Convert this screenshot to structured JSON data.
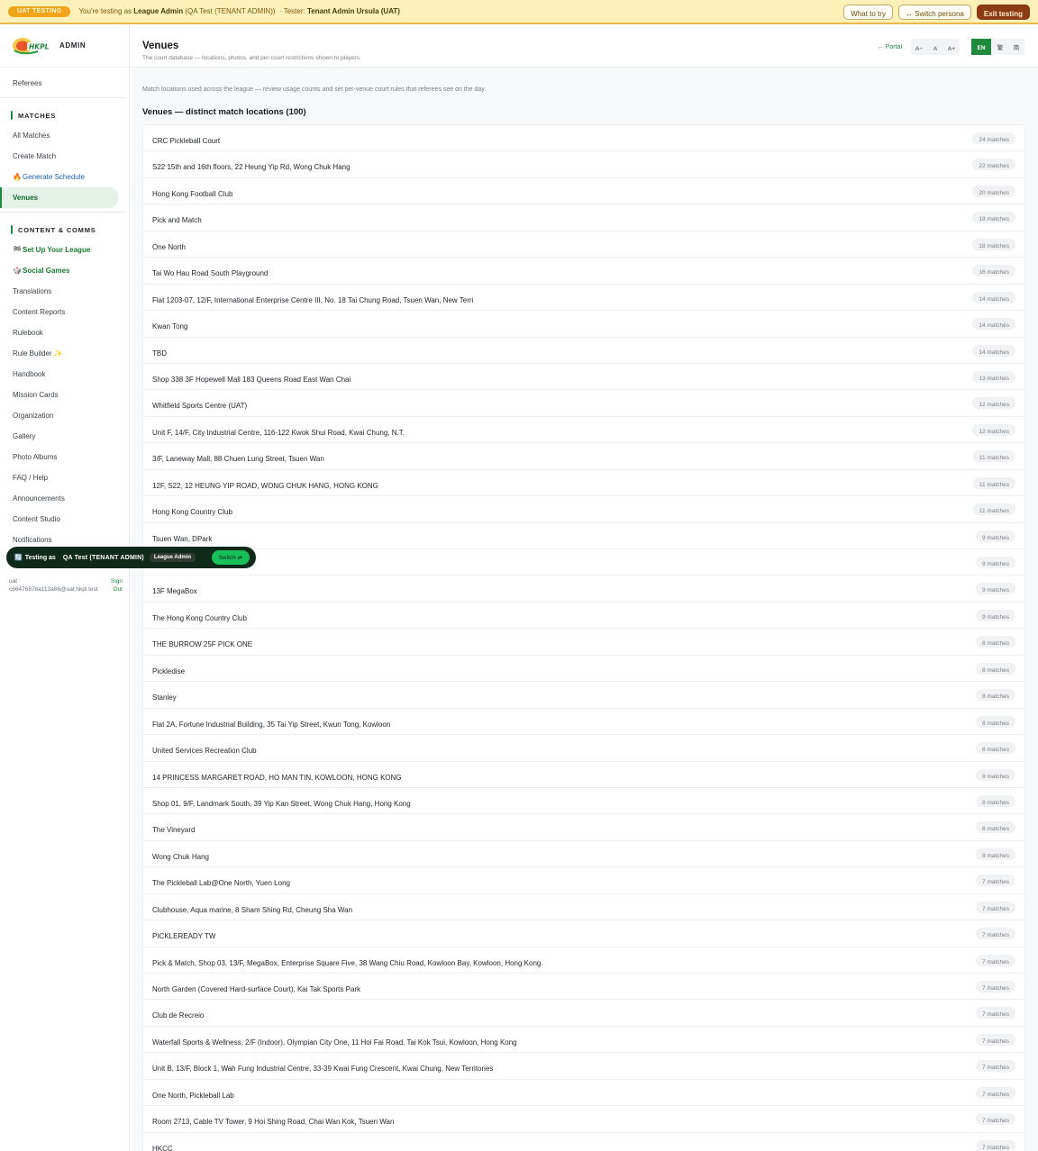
{
  "uat_banner": {
    "pill": "UAT TESTING",
    "prefix": "You're testing as",
    "role": "League Admin",
    "org": "(QA Test (TENANT ADMIN))",
    "tester_label": "· Tester:",
    "tester": "Tenant Admin Ursula (UAT)",
    "what_to_try": "What to try",
    "switch_persona": "↔ Switch persona",
    "exit": "Exit testing"
  },
  "brand": {
    "logo_text": "HKPL",
    "label": "ADMIN"
  },
  "sidebar": {
    "top_items": [
      "Referees"
    ],
    "sections": [
      {
        "heading": "MATCHES",
        "items": [
          {
            "label": "All Matches",
            "icon": "",
            "style": ""
          },
          {
            "label": "Create Match",
            "icon": "",
            "style": ""
          },
          {
            "label": "Generate Schedule",
            "icon": "fire-icon",
            "glyph": "🔥",
            "style": "blue"
          },
          {
            "label": "Venues",
            "icon": "",
            "style": "active"
          }
        ]
      },
      {
        "heading": "CONTENT & COMMS",
        "items": [
          {
            "label": "Set Up Your League",
            "icon": "league-setup-icon",
            "glyph": "🏁",
            "style": "green"
          },
          {
            "label": "Social Games",
            "icon": "dice-icon",
            "glyph": "🎲",
            "style": "green"
          },
          {
            "label": "Translations",
            "icon": "",
            "style": ""
          },
          {
            "label": "Content Reports",
            "icon": "",
            "style": ""
          },
          {
            "label": "Rulebook",
            "icon": "",
            "style": ""
          },
          {
            "label": "Rule Builder ✨",
            "icon": "",
            "style": ""
          },
          {
            "label": "Handbook",
            "icon": "",
            "style": ""
          },
          {
            "label": "Mission Cards",
            "icon": "",
            "style": ""
          },
          {
            "label": "Organization",
            "icon": "",
            "style": ""
          },
          {
            "label": "Gallery",
            "icon": "",
            "style": ""
          },
          {
            "label": "Photo Albums",
            "icon": "",
            "style": ""
          },
          {
            "label": "FAQ / Help",
            "icon": "",
            "style": ""
          },
          {
            "label": "Announcements",
            "icon": "",
            "style": ""
          },
          {
            "label": "Content Studio",
            "icon": "",
            "style": ""
          },
          {
            "label": "Notifications",
            "icon": "",
            "style": ""
          }
        ]
      }
    ],
    "user_line1": "uat",
    "user_email": "c66476878a113a86@uat.hkpl.test",
    "sign_out": "Sign Out"
  },
  "toast": {
    "label": "Testing as",
    "persona": "QA Test (TENANT ADMIN)",
    "role": "League Admin",
    "switch": "Switch ⇄"
  },
  "header": {
    "title": "Venues",
    "subtitle": "The court database — locations, photos, and per-court restrictions shown to players.",
    "portal": "← Portal",
    "font_sizes": [
      "A−",
      "A",
      "A+"
    ],
    "languages": [
      "EN",
      "繁",
      "简"
    ],
    "active_language": "EN"
  },
  "main": {
    "intro": "Match locations used across the league — review usage counts and set per-venue court rules that referees see on the day.",
    "list_title": "Venues — distinct match locations (100)",
    "venues": [
      {
        "name": "CRC Pickleball Court",
        "count": "24 matches"
      },
      {
        "name": "S22 15th and 16th floors, 22 Heung Yip Rd, Wong Chuk Hang",
        "count": "22 matches"
      },
      {
        "name": "Hong Kong Football Club",
        "count": "20 matches"
      },
      {
        "name": "Pick and Match",
        "count": "18 matches"
      },
      {
        "name": "One North",
        "count": "18 matches"
      },
      {
        "name": "Tai Wo Hau Road South Playground",
        "count": "16 matches"
      },
      {
        "name": "Flat 1203-07, 12/F, International Enterprise Centre III, No. 18 Tai Chung Road, Tsuen Wan, New Terri",
        "count": "14 matches"
      },
      {
        "name": "Kwan Tong",
        "count": "14 matches"
      },
      {
        "name": "TBD",
        "count": "14 matches"
      },
      {
        "name": "Shop 338 3F Hopewell Mall 183 Queens Road East Wan Chai",
        "count": "13 matches"
      },
      {
        "name": "Whitfield Sports Centre (UAT)",
        "count": "12 matches"
      },
      {
        "name": "Unit F, 14/F, City Industrial Centre, 116-122 Kwok Shui Road, Kwai Chung, N.T.",
        "count": "12 matches"
      },
      {
        "name": "3/F, Laneway Mall, 88 Chuen Lung Street, Tsuen Wan",
        "count": "11 matches"
      },
      {
        "name": "12F, S22, 12 HEUNG YIP ROAD, WONG CHUK HANG, HONG KONG",
        "count": "11 matches"
      },
      {
        "name": "Hong Kong Country Club",
        "count": "11 matches"
      },
      {
        "name": "Tsuen Wan, DPark",
        "count": "9 matches"
      },
      {
        "name": "EVELS , CENTRAL",
        "count": "9 matches"
      },
      {
        "name": "13F MegaBox",
        "count": "9 matches"
      },
      {
        "name": "The Hong Kong Country Club",
        "count": "9 matches"
      },
      {
        "name": "THE BURROW 25F PICK ONE",
        "count": "8 matches"
      },
      {
        "name": "Pickledise",
        "count": "8 matches"
      },
      {
        "name": "Stanley",
        "count": "8 matches"
      },
      {
        "name": "Flat 2A, Fortune Industrial Building, 35 Tai Yip Street, Kwun Tong, Kowloon",
        "count": "8 matches"
      },
      {
        "name": "United Services Recreation Club",
        "count": "8 matches"
      },
      {
        "name": "14 PRINCESS MARGARET ROAD, HO MAN TIN, KOWLOON, HONG KONG",
        "count": "8 matches"
      },
      {
        "name": "Shop 01, 9/F, Landmark South, 39 Yip Kan Street, Wong Chuk Hang, Hong Kong",
        "count": "8 matches"
      },
      {
        "name": "The Vineyard",
        "count": "8 matches"
      },
      {
        "name": "Wong Chuk Hang",
        "count": "8 matches"
      },
      {
        "name": "The Pickleball Lab@One North, Yuen Long",
        "count": "7 matches"
      },
      {
        "name": "Clubhouse, Aqua marine, 8 Sham Shing Rd, Cheung Sha Wan",
        "count": "7 matches"
      },
      {
        "name": "PICKLEREADY TW",
        "count": "7 matches"
      },
      {
        "name": "Pick & Match, Shop 03, 13/F, MegaBox, Enterprise Square Five, 38 Wang Chiu Road, Kowloon Bay, Kowloon, Hong Kong.",
        "count": "7 matches"
      },
      {
        "name": "North Garden (Covered Hard-surface Court), Kai Tak Sports Park",
        "count": "7 matches"
      },
      {
        "name": "Club de Recreio",
        "count": "7 matches"
      },
      {
        "name": "Waterfall Sports & Wellness, 2/F (Indoor), Olympian City One, 11 Hoi Fai Road, Tai Kok Tsui, Kowloon, Hong Kong",
        "count": "7 matches"
      },
      {
        "name": "Unit B, 13/F, Block 1, Wah Fung Industrial Centre, 33-39 Kwai Fung Crescent, Kwai Chung, New Territories",
        "count": "7 matches"
      },
      {
        "name": "One North, Pickleball Lab",
        "count": "7 matches"
      },
      {
        "name": "Room 2713, Cable TV Tower, 9 Hoi Shing Road, Chai Wan Kok, Tsuen Wan",
        "count": "7 matches"
      },
      {
        "name": "HKCC",
        "count": "7 matches"
      }
    ]
  },
  "colors": {
    "brand_green": "#1f8a3b",
    "uat_yellow": "#fdf0b8",
    "exit_brown": "#8b3b12",
    "toast_bg": "#0f2a1b"
  }
}
